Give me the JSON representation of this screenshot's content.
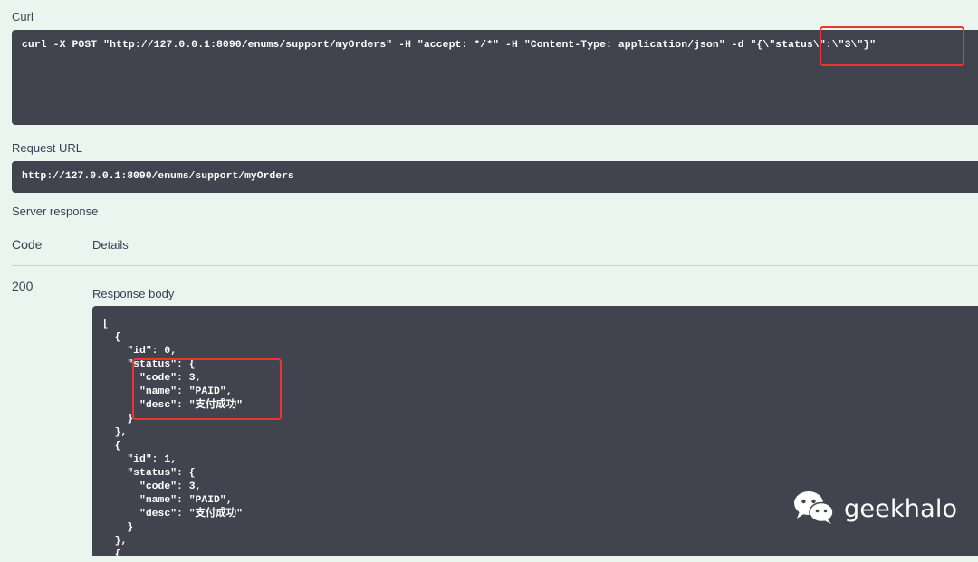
{
  "curl": {
    "label": "Curl",
    "command_main": "curl -X POST \"http://127.0.0.1:8090/enums/support/myOrders\" -H \"accept: */*\" -H \"Content-Type: application/json\" -d ",
    "command_body": "\"{\\\"status\\\":\\\"3\\\"}\""
  },
  "request_url": {
    "label": "Request URL",
    "value": "http://127.0.0.1:8090/enums/support/myOrders"
  },
  "server_response": {
    "label": "Server response",
    "col_code": "Code",
    "col_details": "Details",
    "code": "200",
    "response_body_label": "Response body",
    "body_lines": [
      "[",
      "  {",
      "    \"id\": 0,",
      "    \"status\": {",
      "      \"code\": 3,",
      "      \"name\": \"PAID\",",
      "      \"desc\": \"支付成功\"",
      "    }",
      "  },",
      "  {",
      "    \"id\": 1,",
      "    \"status\": {",
      "      \"code\": 3,",
      "      \"name\": \"PAID\",",
      "      \"desc\": \"支付成功\"",
      "    }",
      "  },",
      "  {"
    ]
  },
  "watermark": {
    "icon": "wechat-icon",
    "text": "geekhalo"
  },
  "colors": {
    "background": "#eaf5f0",
    "code_box": "#41444e",
    "highlight": "#e8372e"
  }
}
